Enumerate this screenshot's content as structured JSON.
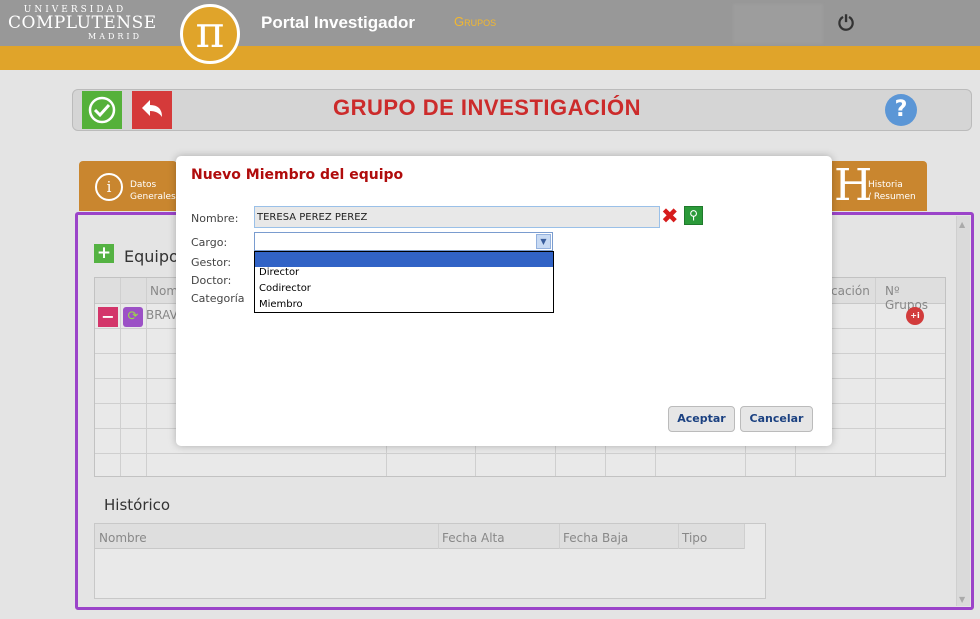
{
  "header": {
    "university_line1": "UNIVERSIDAD",
    "university_line2": "COMPLUTENSE",
    "university_line3": "MADRID",
    "pi_symbol": "π",
    "portal_title": "Portal Investigador",
    "section": "Grupos",
    "power_icon": "power-icon"
  },
  "toolbar": {
    "page_title": "GRUPO DE INVESTIGACIÓN",
    "help_label": "?"
  },
  "tabs": {
    "datos_generales_line1": "Datos",
    "datos_generales_line2": "Generales",
    "datos_icon": "i",
    "historia_line1": "Historia",
    "historia_line2": "/ Resumen",
    "historia_icon": "H"
  },
  "equipo": {
    "title": "Equipo",
    "columns": [
      "Nom",
      "cación",
      "Nº Grupos"
    ],
    "rows": [
      {
        "name": "BRAV"
      }
    ],
    "plus_i_label": "+i"
  },
  "historico": {
    "title": "Histórico",
    "columns": [
      "Nombre",
      "Fecha Alta",
      "Fecha Baja",
      "Tipo"
    ]
  },
  "modal": {
    "title": "Nuevo Miembro del equipo",
    "labels": {
      "nombre": "Nombre:",
      "cargo": "Cargo:",
      "gestor": "Gestor:",
      "doctor": "Doctor:",
      "categoria": "Categoría"
    },
    "nombre_value": "TERESA PEREZ PEREZ",
    "cargo_value": "",
    "cargo_options": [
      "",
      "Director",
      "Codirector",
      "Miembro"
    ],
    "accept_label": "Aceptar",
    "cancel_label": "Cancelar"
  },
  "colors": {
    "accent_orange": "#e0a42a",
    "title_red": "#cc2b2b",
    "panel_border": "#9b44c9",
    "modal_title": "#b00c0c"
  }
}
